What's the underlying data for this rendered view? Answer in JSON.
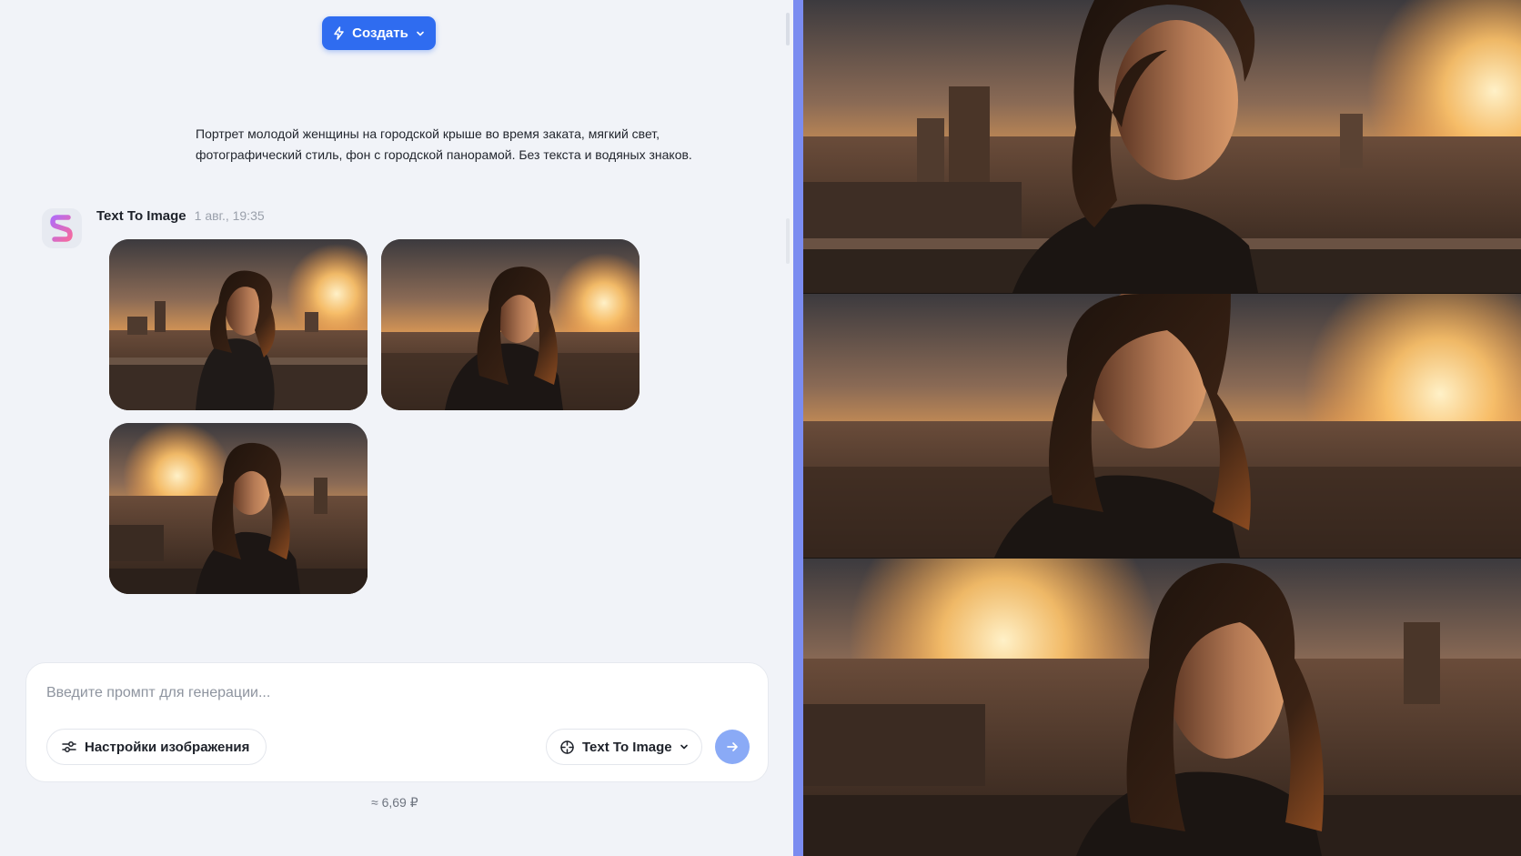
{
  "header": {
    "create_label": "Создать"
  },
  "prompt": {
    "line1": "Портрет молодой женщины на городской крыше во время заката, мягкий свет,",
    "line2": "фотографический стиль, фон с городской панорамой. Без текста и водяных знаков."
  },
  "message": {
    "title": "Text To Image",
    "time": "1 авг., 19:35"
  },
  "composer": {
    "placeholder": "Введите промпт для генерации...",
    "settings_label": "Настройки изображения",
    "model_label": "Text To Image"
  },
  "price": "≈ 6,69 ₽",
  "icons": {
    "create": "lightning-icon",
    "create_chevron": "chevron-down-icon",
    "avatar": "app-logo-icon",
    "settings": "sliders-icon",
    "model": "model-icon",
    "model_chevron": "chevron-down-icon",
    "send": "arrow-right-icon"
  },
  "colors": {
    "accent": "#2f6cf0",
    "divider": "#7b8cf0",
    "send": "#8aaaf6"
  }
}
